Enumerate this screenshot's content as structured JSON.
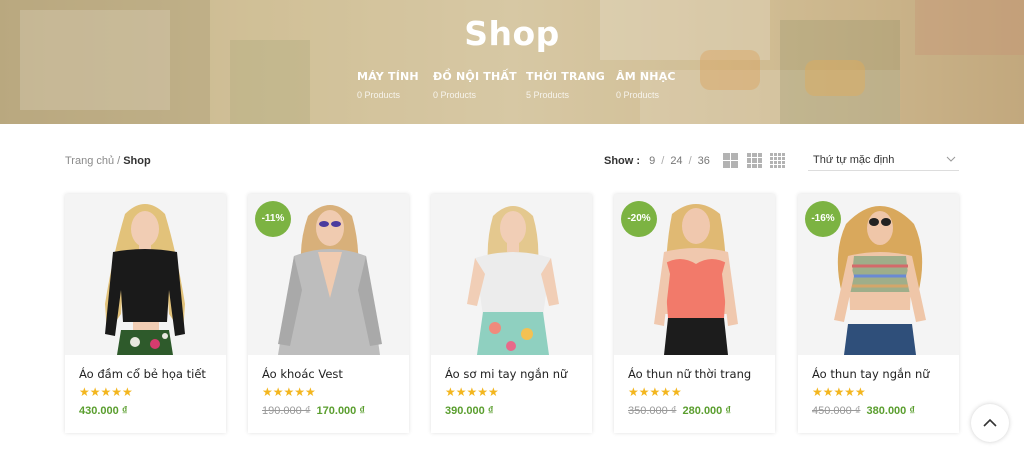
{
  "hero": {
    "title": "Shop",
    "categories": [
      {
        "name": "MÁY TÍNH",
        "count": "0 Products"
      },
      {
        "name": "ĐỒ NỘI THẤT",
        "count": "0 Products"
      },
      {
        "name": "THỜI TRANG",
        "count": "5 Products"
      },
      {
        "name": "ÂM NHẠC",
        "count": "0 Products"
      }
    ]
  },
  "breadcrumb": {
    "home": "Trang chủ",
    "separator": "/",
    "current": "Shop"
  },
  "show": {
    "label": "Show :",
    "options": [
      "9",
      "24",
      "36"
    ],
    "separator": "/"
  },
  "view_icons": [
    "grid-2-icon",
    "grid-3-icon",
    "grid-4-icon"
  ],
  "sort": {
    "selected": "Thứ tự mặc định"
  },
  "products": [
    {
      "name": "Áo đầm cổ bẻ họa tiết",
      "stars": "★★★★★",
      "old_price": "",
      "price": "430.000 ₫",
      "badge": ""
    },
    {
      "name": "Áo khoác Vest",
      "stars": "★★★★★",
      "old_price": "190.000 ₫",
      "price": "170.000 ₫",
      "badge": "-11%"
    },
    {
      "name": "Áo sơ mi tay ngắn nữ",
      "stars": "★★★★★",
      "old_price": "",
      "price": "390.000 ₫",
      "badge": ""
    },
    {
      "name": "Áo thun nữ thời trang",
      "stars": "★★★★★",
      "old_price": "350.000 ₫",
      "price": "280.000 ₫",
      "badge": "-20%"
    },
    {
      "name": "Áo thun tay ngắn nữ",
      "stars": "★★★★★",
      "old_price": "450.000 ₫",
      "price": "380.000 ₫",
      "badge": "-16%"
    }
  ],
  "colors": {
    "accent_green": "#7cb342",
    "price_green": "#5a9e2e",
    "star_yellow": "#f3b61f"
  },
  "back_to_top_icon": "chevron-up-icon"
}
